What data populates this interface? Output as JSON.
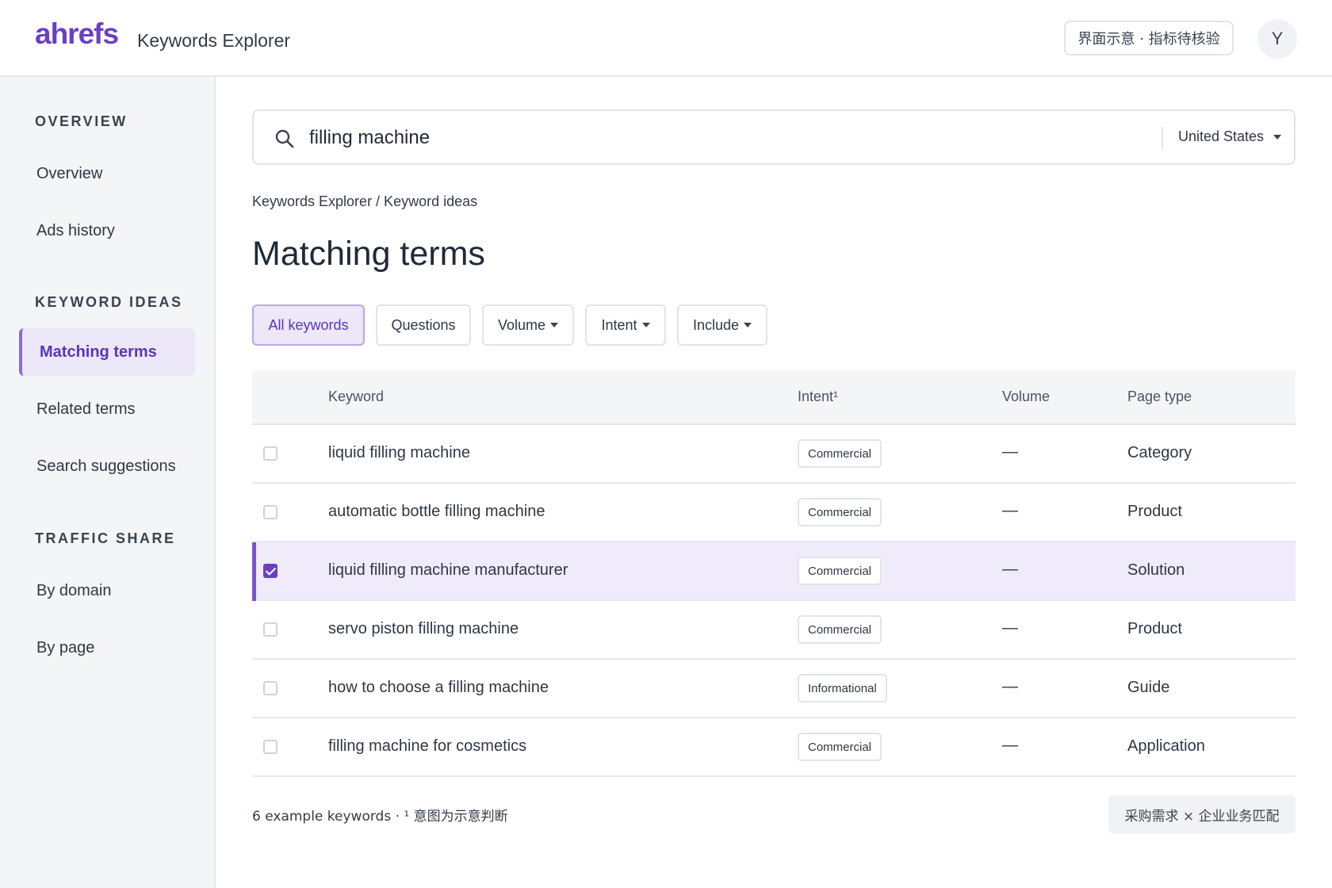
{
  "header": {
    "logo": "ahrefs",
    "app_title": "Keywords Explorer",
    "notice_badge": "界面示意 · 指标待核验",
    "avatar_initial": "Y"
  },
  "sidebar": {
    "sections": [
      {
        "heading": "OVERVIEW",
        "items": [
          {
            "label": "Overview"
          },
          {
            "label": "Ads history"
          }
        ]
      },
      {
        "heading": "KEYWORD IDEAS",
        "items": [
          {
            "label": "Matching terms",
            "active": true
          },
          {
            "label": "Related terms"
          },
          {
            "label": "Search suggestions"
          }
        ]
      },
      {
        "heading": "TRAFFIC SHARE",
        "items": [
          {
            "label": "By domain"
          },
          {
            "label": "By page"
          }
        ]
      }
    ]
  },
  "search": {
    "value": "filling machine",
    "country": "United States"
  },
  "breadcrumb": "Keywords Explorer / Keyword ideas",
  "page_title": "Matching terms",
  "filters": [
    {
      "label": "All keywords",
      "active": true,
      "dropdown": false
    },
    {
      "label": "Questions",
      "active": false,
      "dropdown": false
    },
    {
      "label": "Volume",
      "active": false,
      "dropdown": true
    },
    {
      "label": "Intent",
      "active": false,
      "dropdown": true
    },
    {
      "label": "Include",
      "active": false,
      "dropdown": true
    }
  ],
  "table": {
    "columns": {
      "keyword": "Keyword",
      "intent": "Intent¹",
      "volume": "Volume",
      "page_type": "Page type"
    },
    "rows": [
      {
        "keyword": "liquid filling machine",
        "intent": "Commercial",
        "volume": "—",
        "page_type": "Category",
        "checked": false
      },
      {
        "keyword": "automatic bottle filling machine",
        "intent": "Commercial",
        "volume": "—",
        "page_type": "Product",
        "checked": false
      },
      {
        "keyword": "liquid filling machine manufacturer",
        "intent": "Commercial",
        "volume": "—",
        "page_type": "Solution",
        "checked": true
      },
      {
        "keyword": "servo piston filling machine",
        "intent": "Commercial",
        "volume": "—",
        "page_type": "Product",
        "checked": false
      },
      {
        "keyword": "how to choose a filling machine",
        "intent": "Informational",
        "volume": "—",
        "page_type": "Guide",
        "checked": false
      },
      {
        "keyword": "filling machine for cosmetics",
        "intent": "Commercial",
        "volume": "—",
        "page_type": "Application",
        "checked": false
      }
    ]
  },
  "footer": {
    "note": "6 example keywords · ¹ 意图为示意判断",
    "tag": "采购需求 × 企业业务匹配"
  },
  "colors": {
    "brand": "#6a3fc4",
    "active_bg": "#ece7f9",
    "selected_row_bg": "#efebfa"
  }
}
